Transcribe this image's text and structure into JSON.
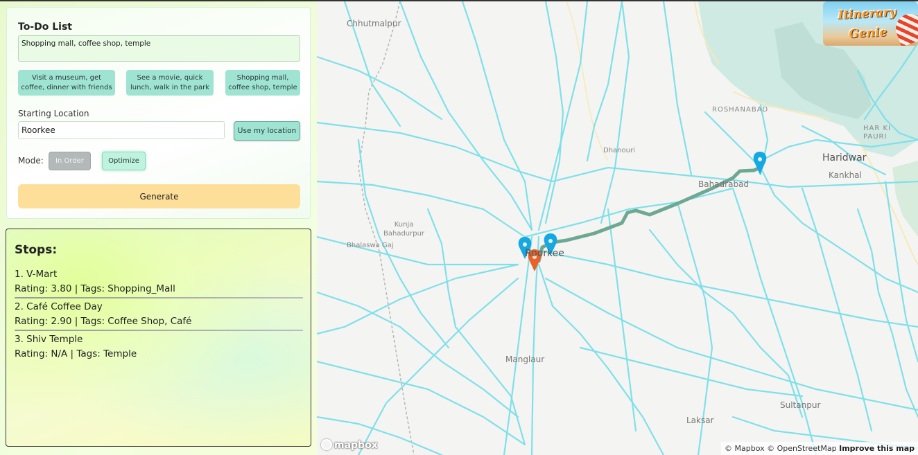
{
  "todo": {
    "title": "To-Do List",
    "value": "Shopping mall, coffee shop, temple"
  },
  "presets": [
    "Visit a museum, get coffee, dinner with friends",
    "See a movie, quick lunch, walk in the park",
    "Shopping mall, coffee shop, temple"
  ],
  "location": {
    "label": "Starting Location",
    "value": "Roorkee",
    "use_button": "Use my location"
  },
  "mode": {
    "label": "Mode:",
    "in_order": "In Order",
    "optimize": "Optimize",
    "selected": "Optimize"
  },
  "generate_label": "Generate",
  "stops": {
    "title": "Stops:",
    "items": [
      {
        "name": "1. V-Mart",
        "info": "Rating: 3.80 | Tags: Shopping_Mall"
      },
      {
        "name": "2. Café Coffee Day",
        "info": "Rating: 2.90 | Tags: Coffee Shop, Café"
      },
      {
        "name": "3. Shiv Temple",
        "info": "Rating: N/A | Tags: Temple"
      }
    ]
  },
  "map": {
    "labels": {
      "chhutmalpur": "Chhutmalpur",
      "roshanabad": "ROSHANABAD",
      "har_ki_pauri": "HAR KI\nPAURI",
      "haridwar": "Haridwar",
      "kankhal": "Kankhal",
      "dhanouri": "Dhanouri",
      "bahadrabad": "Bahadrabad",
      "kunja": "Kunja\nBahadurpur",
      "bhalaswa": "Bhalaswa Gaj",
      "roorkee": "Roorkee",
      "manglaur": "Manglaur",
      "sultanpur": "Sultanpur",
      "laksar": "Laksar"
    },
    "logo_text": "Itinerary Genie",
    "mapbox_logo": "mapbox",
    "attribution": "© Mapbox © OpenStreetMap",
    "improve": "Improve this map"
  },
  "colors": {
    "road": "#7fe0ea",
    "route": "#6ea892",
    "marker_blue": "#16a9e1",
    "marker_orange": "#e8622a"
  }
}
